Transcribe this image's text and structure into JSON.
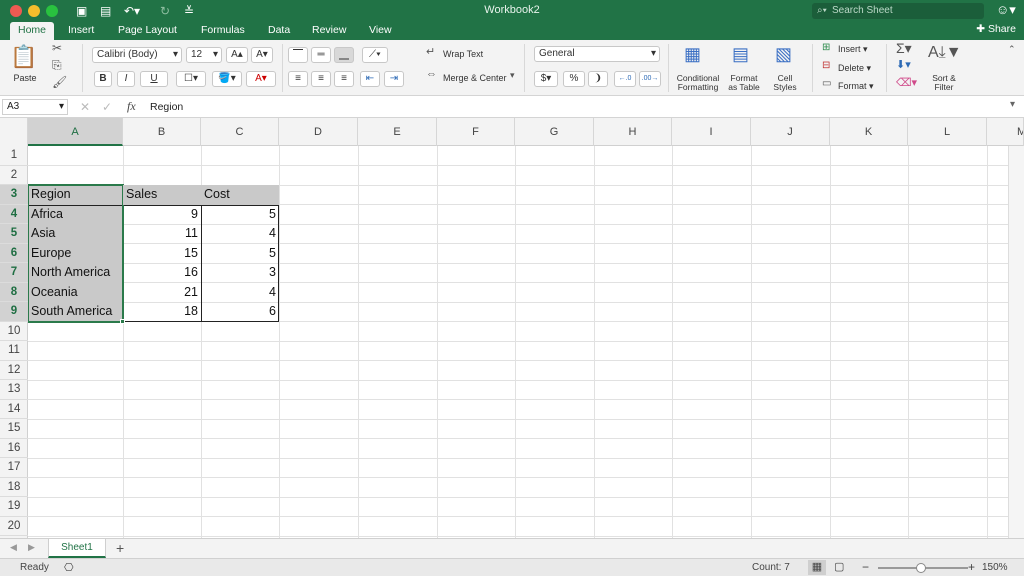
{
  "window": {
    "title": "Workbook2",
    "search_placeholder": "Search Sheet"
  },
  "tabs": [
    {
      "label": "Home",
      "active": true
    },
    {
      "label": "Insert"
    },
    {
      "label": "Page Layout"
    },
    {
      "label": "Formulas"
    },
    {
      "label": "Data"
    },
    {
      "label": "Review"
    },
    {
      "label": "View"
    }
  ],
  "share_label": "Share",
  "ribbon": {
    "paste_label": "Paste",
    "font_name": "Calibri (Body)",
    "font_size": "12",
    "bold": "B",
    "italic": "I",
    "underline": "U",
    "wrap_text": "Wrap Text",
    "merge_center": "Merge & Center",
    "number_format": "General",
    "conditional_formatting": [
      "Conditional",
      "Formatting"
    ],
    "format_as_table": [
      "Format",
      "as Table"
    ],
    "cell_styles": [
      "Cell",
      "Styles"
    ],
    "insert": "Insert",
    "delete": "Delete",
    "format": "Format",
    "sort_filter": [
      "Sort &",
      "Filter"
    ],
    "accent_color": "#217346"
  },
  "formula_bar": {
    "name_box": "A3",
    "fx": "fx",
    "value": "Region"
  },
  "columns": [
    "A",
    "B",
    "C",
    "D",
    "E",
    "F",
    "G",
    "H",
    "I",
    "J",
    "K",
    "L",
    "M"
  ],
  "rows": [
    "1",
    "2",
    "3",
    "4",
    "5",
    "6",
    "7",
    "8",
    "9",
    "10",
    "11",
    "12",
    "13",
    "14",
    "15",
    "16",
    "17",
    "18",
    "19",
    "20"
  ],
  "table": {
    "headers": [
      "Region",
      "Sales",
      "Cost"
    ],
    "rows": [
      [
        "Africa",
        "9",
        "5"
      ],
      [
        "Asia",
        "11",
        "4"
      ],
      [
        "Europe",
        "15",
        "5"
      ],
      [
        "North America",
        "16",
        "3"
      ],
      [
        "Oceania",
        "21",
        "4"
      ],
      [
        "South America",
        "18",
        "6"
      ]
    ]
  },
  "sheet_tabs": [
    "Sheet1"
  ],
  "status": {
    "ready": "Ready",
    "count": "Count: 7",
    "zoom": "150%"
  }
}
